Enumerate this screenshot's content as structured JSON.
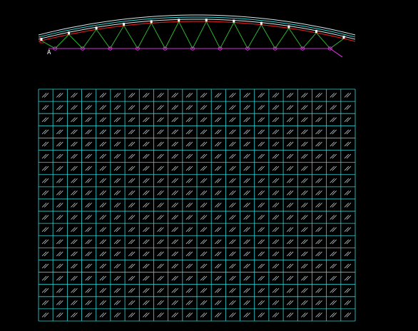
{
  "drawing": {
    "background_color": "#000000",
    "truss": {
      "support_label": "A",
      "panels": 11,
      "colors": {
        "roof_outer": "#d7e7ea",
        "roof_inner": "#2fd6d6",
        "top_chord": "#d31b1b",
        "web_members": "#2ec52e",
        "bottom_chord": "#d22fd6",
        "joint_marker": "#ffffff",
        "bottom_node": "#d22fd6",
        "support": "#ffffff"
      }
    },
    "grid": {
      "columns": 22,
      "rows": 19,
      "line_color": "#2fd6d6",
      "hatch_color": "#d7e7ea"
    }
  }
}
